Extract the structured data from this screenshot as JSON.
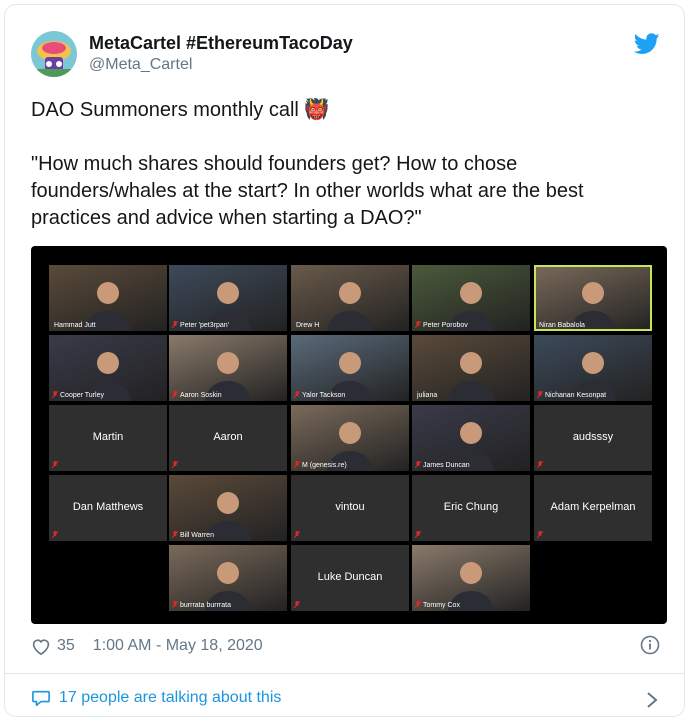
{
  "tweet": {
    "display_name": "MetaCartel #EthereumTacoDay",
    "handle": "@Meta_Cartel",
    "text_line1": "DAO Summoners monthly call 👹",
    "text_quote_1": "\"How much shares should founders get? How to chose",
    "text_quote_2": "founders/whales at the start? In other worlds what are the best",
    "text_quote_3": "practices and advice when starting a DAO?\"",
    "likes": "35",
    "timestamp": "1:00 AM - May 18, 2020",
    "talking": "17 people are talking about this"
  },
  "colors": {
    "brand": "#1da1f2",
    "link": "#1b95e0",
    "muted": "#657786",
    "highlight": "#c7e55a"
  },
  "icons": [
    "twitter-bird-icon",
    "heart-icon",
    "info-icon",
    "speech-bubble-icon",
    "chevron-right-icon",
    "muted-mic-icon"
  ],
  "video_grid": {
    "rows": [
      [
        {
          "label": "Hammad Jutt",
          "video": true,
          "muted": false
        },
        {
          "label": "Peter 'pet3rpan'",
          "video": true,
          "muted": true
        },
        {
          "label": "Drew H",
          "video": true,
          "muted": false
        },
        {
          "label": "Peter Porobov",
          "video": true,
          "muted": true
        },
        {
          "label": "Niran Babalola",
          "video": true,
          "muted": false,
          "active": true
        }
      ],
      [
        {
          "label": "Cooper Turley",
          "video": true,
          "muted": true
        },
        {
          "label": "Aaron Soskin",
          "video": true,
          "muted": true
        },
        {
          "label": "Yalor Tackson",
          "video": true,
          "muted": true
        },
        {
          "label": "juliana",
          "video": true,
          "muted": false
        },
        {
          "label": "Nichanan Kesonpat",
          "video": true,
          "muted": true
        }
      ],
      [
        {
          "label": "Martin",
          "video": false,
          "muted": true
        },
        {
          "label": "Aaron",
          "video": false,
          "muted": true
        },
        {
          "label": "M (genesis.re)",
          "video": true,
          "muted": true
        },
        {
          "label": "James Duncan",
          "video": true,
          "muted": true
        },
        {
          "label": "audsssy",
          "video": false,
          "muted": true
        }
      ],
      [
        {
          "label": "Dan Matthews",
          "video": false,
          "muted": true
        },
        {
          "label": "Bill Warren",
          "video": true,
          "muted": true
        },
        {
          "label": "vintou",
          "video": false,
          "muted": true
        },
        {
          "label": "Eric Chung",
          "video": false,
          "muted": true
        },
        {
          "label": "Adam Kerpelman",
          "video": false,
          "muted": true
        }
      ],
      [
        {
          "label": "burrrata burrrata",
          "video": true,
          "muted": true
        },
        {
          "label": "Luke Duncan",
          "video": false,
          "muted": true
        },
        {
          "label": "Tommy Cox",
          "video": true,
          "muted": true
        }
      ]
    ]
  }
}
